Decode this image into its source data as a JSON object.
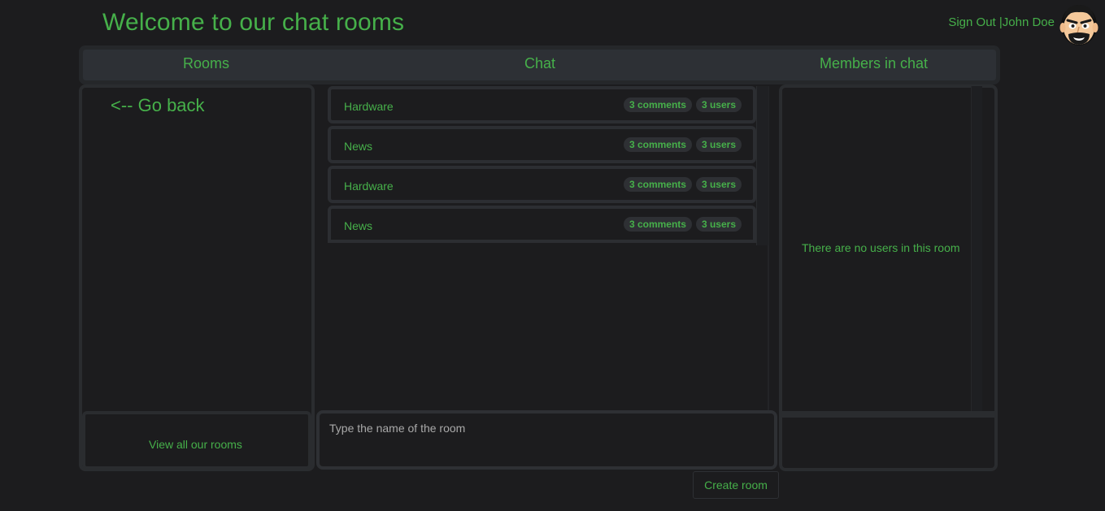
{
  "header": {
    "title": "Welcome to our chat rooms",
    "sign_out": "Sign Out |",
    "user_name": "John Doe"
  },
  "columns": {
    "rooms": "Rooms",
    "chat": "Chat",
    "members": "Members in chat"
  },
  "rooms_panel": {
    "go_back": "<-- Go back",
    "view_all": "View all our rooms"
  },
  "room_list": [
    {
      "name": "Hardware",
      "comments": "3 comments",
      "users": "3 users"
    },
    {
      "name": "News",
      "comments": "3 comments",
      "users": "3 users"
    },
    {
      "name": "Hardware",
      "comments": "3 comments",
      "users": "3 users"
    },
    {
      "name": "News",
      "comments": "3 comments",
      "users": "3 users"
    }
  ],
  "create_form": {
    "placeholder": "Type the name of the room",
    "button": "Create room"
  },
  "members_panel": {
    "empty_message": "There are no users in this room"
  },
  "colors": {
    "accent": "#46b04a",
    "background": "#1c1c1e",
    "panel_border": "#2a2c2f"
  }
}
